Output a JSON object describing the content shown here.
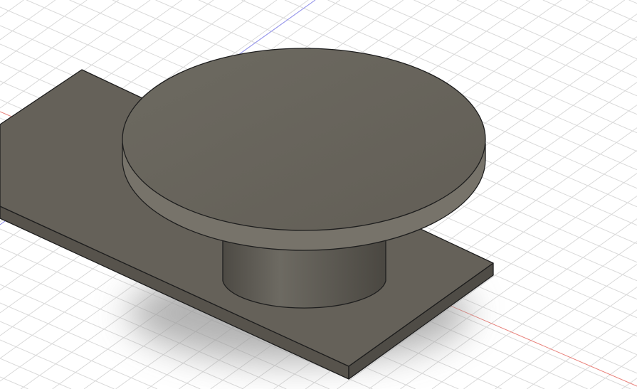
{
  "viewport": {
    "background": "#ffffff",
    "grid_color": "#d9d9d9",
    "x_axis_color": "#e8807a",
    "z_axis_color": "#8a8ae8"
  },
  "model": {
    "plate_top_color": "#656159",
    "plate_side_color": "#57534c",
    "disc_top_color": "#666258",
    "disc_rim_color": "#77736a",
    "stem_color": "#5f5b54",
    "edge_color": "#1e1e1e",
    "shadow_color": "#9a9a9a"
  }
}
